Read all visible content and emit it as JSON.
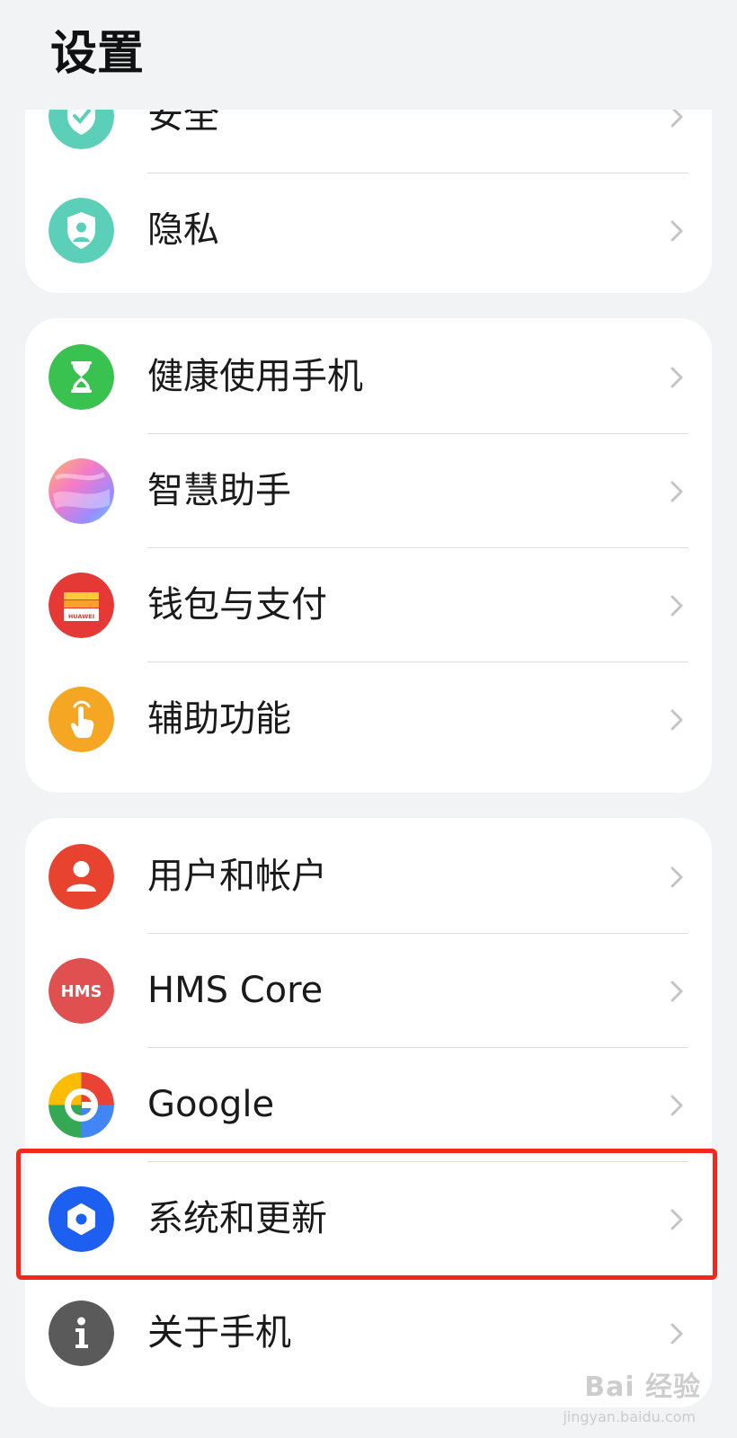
{
  "page": {
    "title": "设置"
  },
  "groups": [
    {
      "items": [
        {
          "label": "安全",
          "icon": "security-shield-icon",
          "color": "#5ccfb9"
        },
        {
          "label": "隐私",
          "icon": "privacy-shield-icon",
          "color": "#5ccfb9"
        }
      ]
    },
    {
      "items": [
        {
          "label": "健康使用手机",
          "icon": "hourglass-icon",
          "color": "#39c24f"
        },
        {
          "label": "智慧助手",
          "icon": "smart-assistant-icon",
          "color": "#b8a6ff"
        },
        {
          "label": "钱包与支付",
          "icon": "wallet-icon",
          "color": "#e53935"
        },
        {
          "label": "辅助功能",
          "icon": "hand-tap-icon",
          "color": "#f5a623"
        }
      ]
    },
    {
      "items": [
        {
          "label": "用户和帐户",
          "icon": "user-icon",
          "color": "#e8432f"
        },
        {
          "label": "HMS Core",
          "icon": "hms-core-icon",
          "color": "#e05050",
          "icon_text": "HMS"
        },
        {
          "label": "Google",
          "icon": "google-icon",
          "color": "#4285f4"
        },
        {
          "label": "系统和更新",
          "icon": "gear-icon",
          "color": "#1d5ff0"
        },
        {
          "label": "关于手机",
          "icon": "info-icon",
          "color": "#5a5a5a"
        }
      ]
    }
  ],
  "wallet_icon_text": "HUAWEI",
  "watermark": {
    "main": "Bai 经验",
    "sub": "jingyan.baidu.com"
  },
  "highlight": {
    "target": "系统和更新",
    "color": "#f2281d"
  }
}
